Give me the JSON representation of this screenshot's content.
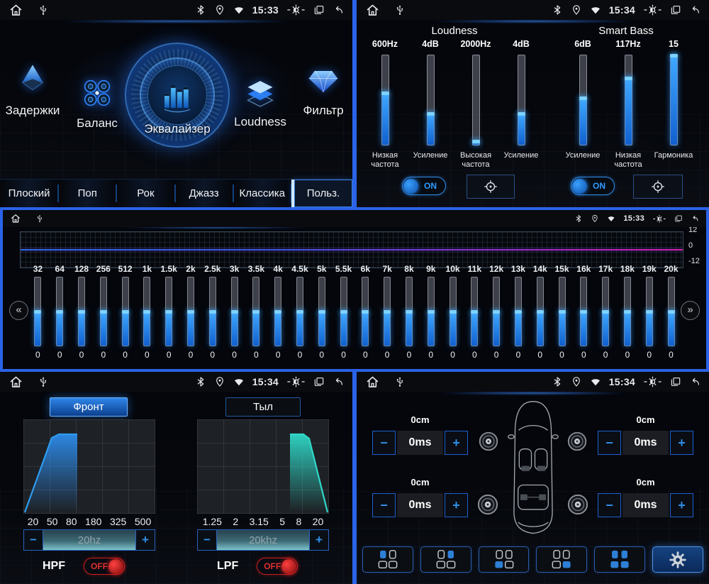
{
  "symbols": {
    "minus": "−",
    "plus": "+"
  },
  "status": {
    "tl_time": "15:33",
    "tr_time": "15:34",
    "mid_time": "15:33",
    "bl_time": "15:34",
    "br_time": "15:34"
  },
  "menu": {
    "items": [
      {
        "label": "Задержки"
      },
      {
        "label": "Баланс"
      },
      {
        "label": "Эквалайзер"
      },
      {
        "label": "Loudness"
      },
      {
        "label": "Фильтр"
      }
    ],
    "presets": [
      {
        "label": "Плоский",
        "selected": false
      },
      {
        "label": "Поп",
        "selected": false
      },
      {
        "label": "Рок",
        "selected": false
      },
      {
        "label": "Джазз",
        "selected": false
      },
      {
        "label": "Классика",
        "selected": false
      },
      {
        "label": "Польз.",
        "selected": true
      }
    ]
  },
  "loudness": {
    "title": "Loudness",
    "toggle": "ON",
    "sliders": [
      {
        "value": "600Hz",
        "label": "Низкая частота",
        "fill_pct": 58
      },
      {
        "value": "4dB",
        "label": "Усиление",
        "fill_pct": 35
      },
      {
        "value": "2000Hz",
        "label": "Высокая частота",
        "fill_pct": 4
      },
      {
        "value": "4dB",
        "label": "Усиление",
        "fill_pct": 35
      }
    ]
  },
  "smart_bass": {
    "title": "Smart Bass",
    "toggle": "ON",
    "sliders": [
      {
        "value": "6dB",
        "label": "Усиление",
        "fill_pct": 52
      },
      {
        "value": "117Hz",
        "label": "Низкая частота",
        "fill_pct": 75
      },
      {
        "value": "15",
        "label": "Гармоника",
        "fill_pct": 100
      }
    ]
  },
  "equalizer": {
    "scale": [
      "12",
      "0",
      "-12"
    ],
    "prev_icon": "«",
    "next_icon": "»",
    "bands": [
      {
        "f": "32",
        "v": "0"
      },
      {
        "f": "64",
        "v": "0"
      },
      {
        "f": "128",
        "v": "0"
      },
      {
        "f": "256",
        "v": "0"
      },
      {
        "f": "512",
        "v": "0"
      },
      {
        "f": "1k",
        "v": "0"
      },
      {
        "f": "1.5k",
        "v": "0"
      },
      {
        "f": "2k",
        "v": "0"
      },
      {
        "f": "2.5k",
        "v": "0"
      },
      {
        "f": "3k",
        "v": "0"
      },
      {
        "f": "3.5k",
        "v": "0"
      },
      {
        "f": "4k",
        "v": "0"
      },
      {
        "f": "4.5k",
        "v": "0"
      },
      {
        "f": "5k",
        "v": "0"
      },
      {
        "f": "5.5k",
        "v": "0"
      },
      {
        "f": "6k",
        "v": "0"
      },
      {
        "f": "7k",
        "v": "0"
      },
      {
        "f": "8k",
        "v": "0"
      },
      {
        "f": "9k",
        "v": "0"
      },
      {
        "f": "10k",
        "v": "0"
      },
      {
        "f": "11k",
        "v": "0"
      },
      {
        "f": "12k",
        "v": "0"
      },
      {
        "f": "13k",
        "v": "0"
      },
      {
        "f": "14k",
        "v": "0"
      },
      {
        "f": "15k",
        "v": "0"
      },
      {
        "f": "16k",
        "v": "0"
      },
      {
        "f": "17k",
        "v": "0"
      },
      {
        "f": "18k",
        "v": "0"
      },
      {
        "f": "19k",
        "v": "0"
      },
      {
        "f": "20k",
        "v": "0"
      }
    ]
  },
  "crossover": {
    "tabs": [
      {
        "label": "Фронт",
        "selected": true
      },
      {
        "label": "Тыл",
        "selected": false
      }
    ],
    "hpf": {
      "name": "HPF",
      "state": "OFF",
      "slider": "20hz",
      "ticks": [
        "20",
        "50",
        "80",
        "180",
        "325",
        "500"
      ]
    },
    "lpf": {
      "name": "LPF",
      "state": "OFF",
      "slider": "20khz",
      "ticks": [
        "1.25",
        "2",
        "3.15",
        "5",
        "8",
        "20"
      ]
    }
  },
  "delays": {
    "front_left": {
      "cm": "0cm",
      "ms": "0ms"
    },
    "front_right": {
      "cm": "0cm",
      "ms": "0ms"
    },
    "rear_left": {
      "cm": "0cm",
      "ms": "0ms"
    },
    "rear_right": {
      "cm": "0cm",
      "ms": "0ms"
    },
    "positions": [
      {
        "name": "front-left",
        "seats": [
          "fl"
        ]
      },
      {
        "name": "front-right",
        "seats": [
          "fr"
        ]
      },
      {
        "name": "rear-left",
        "seats": [
          "rl"
        ]
      },
      {
        "name": "rear-right",
        "seats": [
          "rr"
        ]
      },
      {
        "name": "all",
        "seats": [
          "fl",
          "fr",
          "rl",
          "rr"
        ]
      },
      {
        "name": "settings",
        "gear": true,
        "seats": []
      }
    ]
  }
}
